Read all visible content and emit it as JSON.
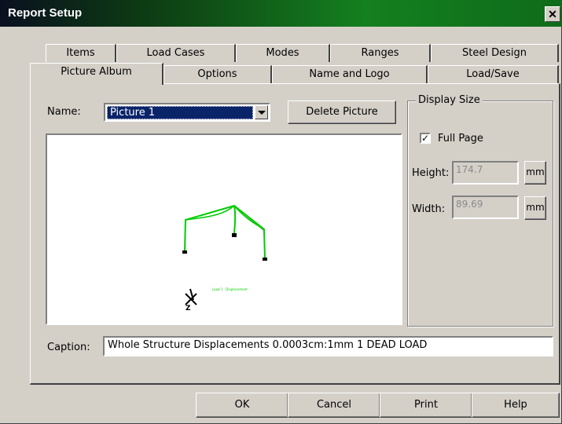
{
  "window": {
    "title": "Report Setup",
    "close_glyph": "✕"
  },
  "tabs_back": [
    "Items",
    "Load Cases",
    "Modes",
    "Ranges",
    "Steel Design"
  ],
  "tabs_front": [
    "Picture Album",
    "Options",
    "Name and Logo",
    "Load/Save"
  ],
  "active_tab": "Picture Album",
  "name": {
    "label": "Name:",
    "selected": "Picture 1"
  },
  "delete_button": "Delete Picture",
  "display_size": {
    "title": "Display Size",
    "full_page_label": "Full Page",
    "full_page_checked": true,
    "height_label": "Height:",
    "height_value": "174.7",
    "height_unit": "mm",
    "width_label": "Width:",
    "width_value": "89.69",
    "width_unit": "mm"
  },
  "preview": {
    "legend_text": "Load 1 : Displacement",
    "axis_glyph": "Z"
  },
  "caption": {
    "label": "Caption:",
    "value": "Whole Structure Displacements 0.0003cm:1mm 1 DEAD LOAD"
  },
  "buttons": {
    "ok": "OK",
    "cancel": "Cancel",
    "print": "Print",
    "help": "Help"
  },
  "colors": {
    "structure_green": "#00cc00",
    "title_gradient_end": "#14801f",
    "selection": "#0a246a"
  }
}
